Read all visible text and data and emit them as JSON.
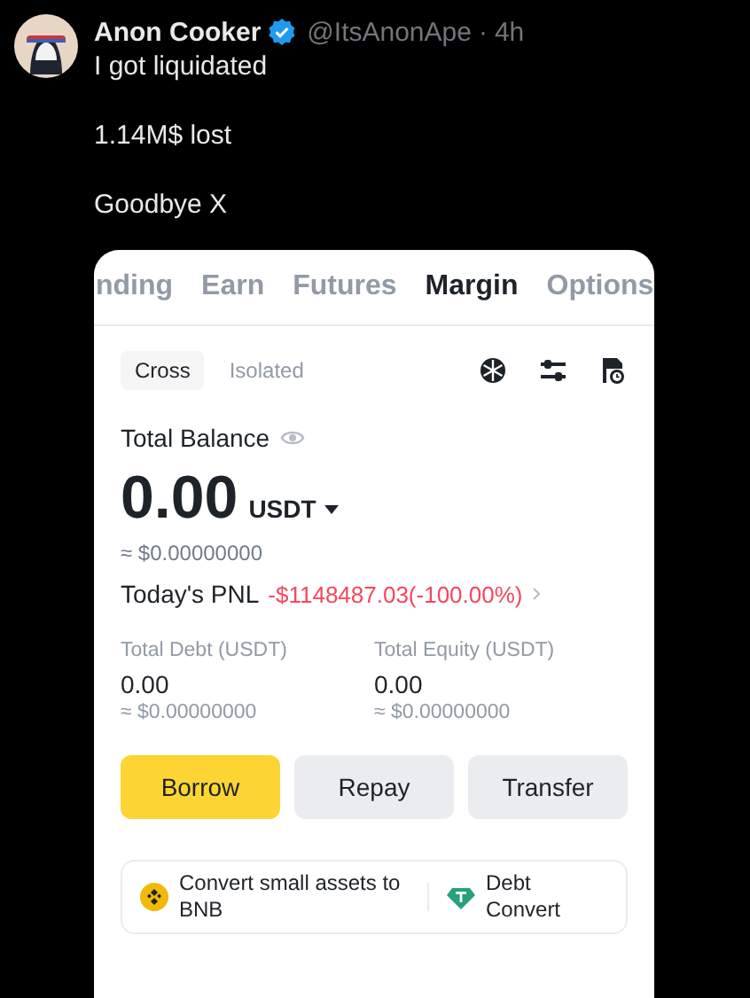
{
  "tweet": {
    "author": "Anon Cooker",
    "verified": true,
    "handle": "@ItsAnonApe",
    "separator": "·",
    "time": "4h",
    "paragraphs": [
      "I got liquidated",
      "1.14M$ lost",
      "Goodbye X"
    ]
  },
  "screenshot": {
    "tabs": [
      {
        "label": "nding",
        "selected": false
      },
      {
        "label": "Earn",
        "selected": false
      },
      {
        "label": "Futures",
        "selected": false
      },
      {
        "label": "Margin",
        "selected": true
      },
      {
        "label": "Options",
        "selected": false
      }
    ],
    "modes": [
      {
        "label": "Cross",
        "selected": true
      },
      {
        "label": "Isolated",
        "selected": false
      }
    ],
    "balance": {
      "label": "Total Balance",
      "amount": "0.00",
      "currency": "USDT",
      "approx": "≈ $0.00000000",
      "pnl_label": "Today's PNL",
      "pnl_value": "-$1148487.03(-100.00%)"
    },
    "stats": [
      {
        "label": "Total Debt (USDT)",
        "value": "0.00",
        "approx": "≈ $0.00000000"
      },
      {
        "label": "Total Equity (USDT)",
        "value": "0.00",
        "approx": "≈ $0.00000000"
      }
    ],
    "buttons": [
      {
        "label": "Borrow",
        "kind": "primary"
      },
      {
        "label": "Repay",
        "kind": "secondary"
      },
      {
        "label": "Transfer",
        "kind": "secondary"
      }
    ],
    "promos": [
      {
        "label": "Convert small assets to BNB",
        "kind": "bnb"
      },
      {
        "label": "Debt Convert",
        "kind": "tether"
      }
    ]
  }
}
